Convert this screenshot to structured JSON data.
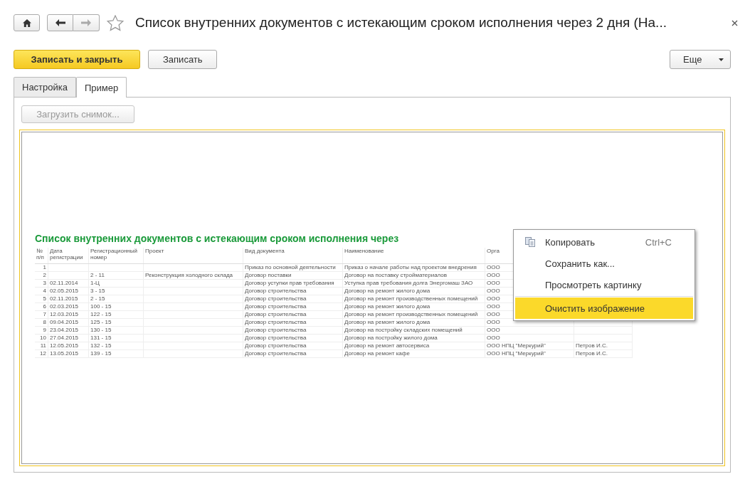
{
  "header": {
    "title": "Список внутренних документов с истекающим сроком исполнения через 2 дня (На..."
  },
  "command_bar": {
    "buttons": [
      {
        "label": "Записать и закрыть",
        "kind": "primary"
      },
      {
        "label": "Записать",
        "kind": "normal"
      }
    ],
    "more_button": {
      "label": "Еще"
    }
  },
  "tabs": [
    {
      "label": "Настройка",
      "selected": false
    },
    {
      "label": "Пример",
      "selected": true
    }
  ],
  "load_button": {
    "label": "Загрузить снимок...",
    "disabled": true
  },
  "picture": {
    "report": {
      "title": "Список внутренних документов с истекающим сроком исполнения через",
      "columns": [
        "№ п/п",
        "Дата регистрации",
        "Регистрационный номер",
        "Проект",
        "Вид документа",
        "Наименование",
        "Орга",
        ""
      ],
      "rows": [
        [
          "1",
          "",
          "",
          "",
          "Приказ по основной деятельности",
          "Приказ о начале работы над проектом внедрения",
          "ООО",
          ""
        ],
        [
          "2",
          "",
          "2 - 11",
          "Реконструкция холодного склада",
          "Договор поставки",
          "Договор на поставку стройматериалов",
          "ООО",
          ""
        ],
        [
          "3",
          "02.11.2014",
          "1-Ц",
          "",
          "Договор уступки прав требования",
          "Уступка прав требования долга Энергомаш ЗАО",
          "ООО",
          ""
        ],
        [
          "4",
          "02.05.2015",
          "3 - 15",
          "",
          "Договор строительства",
          "Договор на ремонт жилого дома",
          "ООО",
          ""
        ],
        [
          "5",
          "02.11.2015",
          "2 - 15",
          "",
          "Договор строительства",
          "Договор на ремонт производственных помещений",
          "ООО",
          ""
        ],
        [
          "6",
          "02.03.2015",
          "100 - 15",
          "",
          "Договор строительства",
          "Договор на ремонт жилого дома",
          "ООО",
          ""
        ],
        [
          "7",
          "12.03.2015",
          "122 - 15",
          "",
          "Договор строительства",
          "Договор на ремонт производственных помещений",
          "ООО",
          ""
        ],
        [
          "8",
          "09.04.2015",
          "125 - 15",
          "",
          "Договор строительства",
          "Договор на ремонт жилого дома",
          "ООО",
          ""
        ],
        [
          "9",
          "23.04.2015",
          "130 - 15",
          "",
          "Договор строительства",
          "Договор на постройку складских помещений",
          "ООО",
          ""
        ],
        [
          "10",
          "27.04.2015",
          "131 - 15",
          "",
          "Договор строительства",
          "Договор на постройку жилого дома",
          "ООО",
          ""
        ],
        [
          "11",
          "12.05.2015",
          "132 - 15",
          "",
          "Договор строительства",
          "Договор на ремонт автосервиса",
          "ООО НПЦ \"Меркурий\"",
          "Петров И.С."
        ],
        [
          "12",
          "13.05.2015",
          "139 - 15",
          "",
          "Договор строительства",
          "Договор на ремонт кафе",
          "ООО НПЦ \"Меркурий\"",
          "Петров И.С."
        ]
      ]
    }
  },
  "context_menu": {
    "items": [
      {
        "label": "Копировать",
        "shortcut": "Ctrl+C",
        "has_icon": true,
        "selected": false
      },
      {
        "label": "Сохранить как...",
        "has_icon": false,
        "selected": false
      },
      {
        "label": "Просмотреть картинку",
        "has_icon": false,
        "selected": false,
        "separator_after": true
      },
      {
        "label": "Очистить изображение",
        "has_icon": false,
        "selected": true
      }
    ]
  }
}
